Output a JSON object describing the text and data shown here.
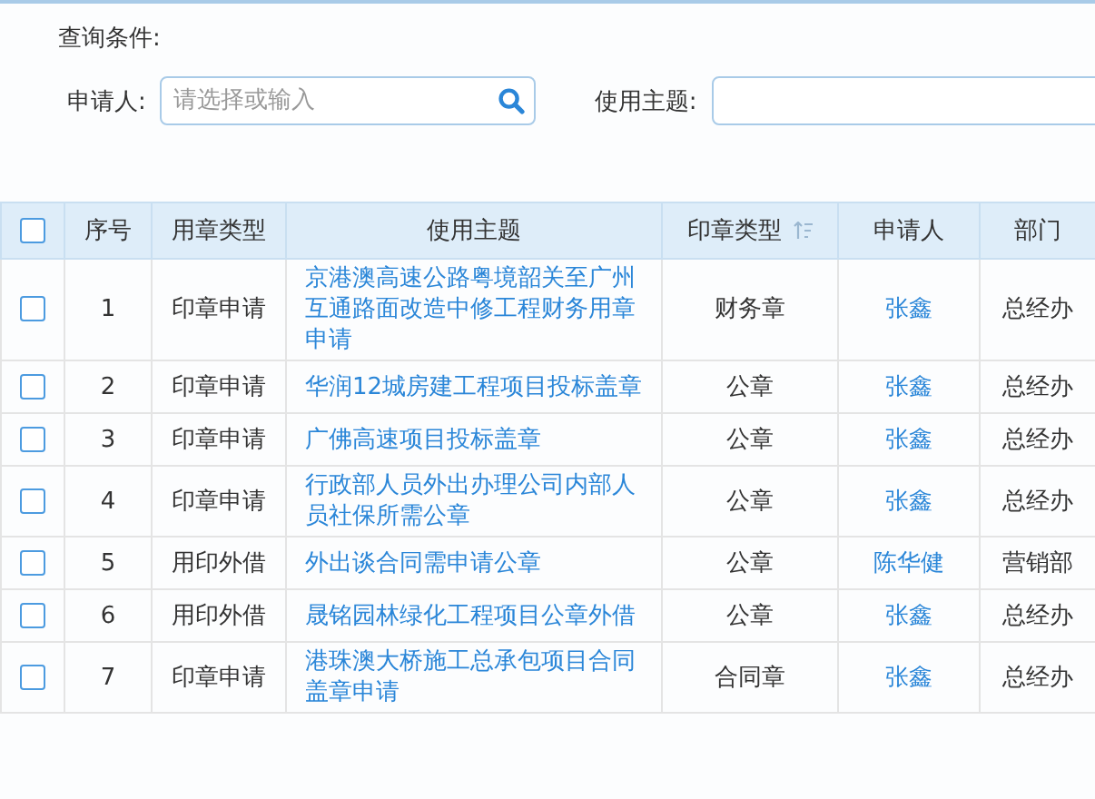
{
  "query": {
    "title": "查询条件:",
    "fields": [
      {
        "label": "申请人:",
        "placeholder": "请选择或输入",
        "search": true
      },
      {
        "label": "使用主题:",
        "search": false
      }
    ]
  },
  "table": {
    "select_all": {
      "checked": false
    },
    "columns": [
      {
        "label": "序号",
        "sortable": false
      },
      {
        "label": "用章类型",
        "sortable": false
      },
      {
        "label": "使用主题",
        "sortable": false
      },
      {
        "label": "印章类型",
        "sortable": true
      },
      {
        "label": "申请人",
        "sortable": false
      },
      {
        "label": "部门",
        "sortable": false
      }
    ],
    "rows": [
      {
        "checked": false,
        "no": "1",
        "type": "印章申请",
        "subject": "京港澳高速公路粤境韶关至广州互通路面改造中修工程财务用章申请",
        "seal": "财务章",
        "applicant": "张鑫",
        "dept": "总经办"
      },
      {
        "checked": false,
        "no": "2",
        "type": "印章申请",
        "subject": "华润12城房建工程项目投标盖章",
        "seal": "公章",
        "applicant": "张鑫",
        "dept": "总经办"
      },
      {
        "checked": false,
        "no": "3",
        "type": "印章申请",
        "subject": "广佛高速项目投标盖章",
        "seal": "公章",
        "applicant": "张鑫",
        "dept": "总经办"
      },
      {
        "checked": false,
        "no": "4",
        "type": "印章申请",
        "subject": "行政部人员外出办理公司内部人员社保所需公章",
        "seal": "公章",
        "applicant": "张鑫",
        "dept": "总经办"
      },
      {
        "checked": false,
        "no": "5",
        "type": "用印外借",
        "subject": "外出谈合同需申请公章",
        "seal": "公章",
        "applicant": "陈华健",
        "dept": "营销部"
      },
      {
        "checked": false,
        "no": "6",
        "type": "用印外借",
        "subject": "晟铭园林绿化工程项目公章外借",
        "seal": "公章",
        "applicant": "张鑫",
        "dept": "总经办"
      },
      {
        "checked": false,
        "no": "7",
        "type": "印章申请",
        "subject": "港珠澳大桥施工总承包项目合同盖章申请",
        "seal": "合同章",
        "applicant": "张鑫",
        "dept": "总经办"
      }
    ]
  }
}
